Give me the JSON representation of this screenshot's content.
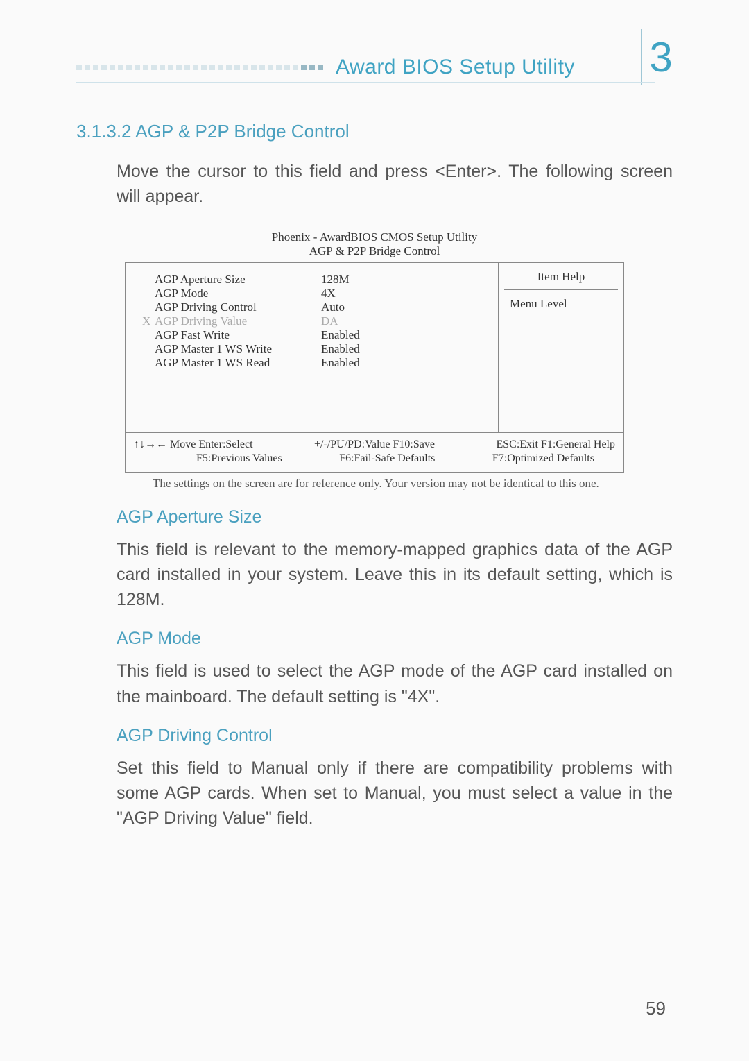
{
  "header": {
    "title": "Award BIOS Setup Utility",
    "chapter_number": "3"
  },
  "section": {
    "number_title": "3.1.3.2  AGP & P2P Bridge Control",
    "intro": "Move the cursor to this field and press <Enter>. The following screen will appear."
  },
  "bios": {
    "caption_line1": "Phoenix - AwardBIOS CMOS Setup Utility",
    "caption_line2": "AGP & P2P Bridge Control",
    "rows": [
      {
        "x": "",
        "label": "AGP Aperture Size",
        "value": "128M"
      },
      {
        "x": "",
        "label": "AGP Mode",
        "value": "4X"
      },
      {
        "x": "",
        "label": "AGP Driving Control",
        "value": "Auto"
      },
      {
        "x": "X",
        "label": "AGP Driving Value",
        "value": "DA"
      },
      {
        "x": "",
        "label": "AGP Fast Write",
        "value": "Enabled"
      },
      {
        "x": "",
        "label": "AGP Master 1 WS Write",
        "value": "Enabled"
      },
      {
        "x": "",
        "label": "AGP Master 1 WS Read",
        "value": "Enabled"
      }
    ],
    "help_title": "Item Help",
    "menu_level": "Menu Level",
    "footer": {
      "l1a": "↑↓→← Move   Enter:Select",
      "l1b": "+/-/PU/PD:Value   F10:Save",
      "l1c": "ESC:Exit   F1:General Help",
      "l2a": "F5:Previous Values",
      "l2b": "F6:Fail-Safe Defaults",
      "l2c": "F7:Optimized Defaults"
    }
  },
  "note": "The settings on the screen are for reference only. Your version may not be identical to this one.",
  "subsections": {
    "aperture": {
      "title": "AGP Aperture Size",
      "body": "This field is relevant to the memory-mapped graphics data of the AGP card installed in your system. Leave this in its default setting, which is 128M."
    },
    "mode": {
      "title": "AGP Mode",
      "body": "This field is used to select the AGP mode of the AGP card installed on the mainboard. The default setting is \"4X\"."
    },
    "driving": {
      "title": "AGP Driving Control",
      "body": "Set this field to Manual only if there are compatibility problems with some AGP cards. When set to Manual, you must select a value in the \"AGP Driving Value\" field."
    }
  },
  "page_number": "59"
}
